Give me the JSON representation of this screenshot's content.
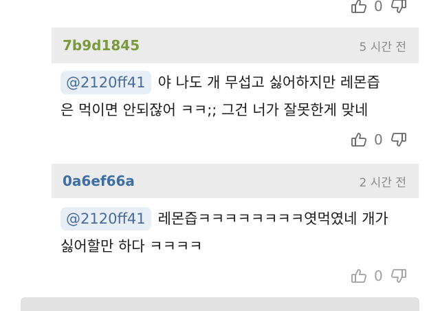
{
  "top_vote": {
    "like_count": "0",
    "like_icon": "thumbs-up-icon",
    "dislike_icon": "thumbs-down-icon"
  },
  "replies": [
    {
      "username": "7b9d1845",
      "time": "5 시간 전",
      "mention": "@2120ff41",
      "text_line1": "야 나도 개 무섭고 싫어하지만 레몬즙",
      "text_line2": "은 먹이면 안되잖어 ㅋㅋ;; 그건 너가 잘못한게 맞네",
      "like_count": "0",
      "username_color": "#7b9a3e"
    },
    {
      "username": "0a6ef66a",
      "time": "2 시간 전",
      "mention": "@2120ff41",
      "text_line1": "레몬즙ㅋㅋㅋㅋㅋㅋㅋㅋ엿먹였네 개가",
      "text_line2": "싫어할만 하다 ㅋㅋㅋㅋ",
      "like_count": "0",
      "username_color": "#3f6ea5"
    }
  ]
}
